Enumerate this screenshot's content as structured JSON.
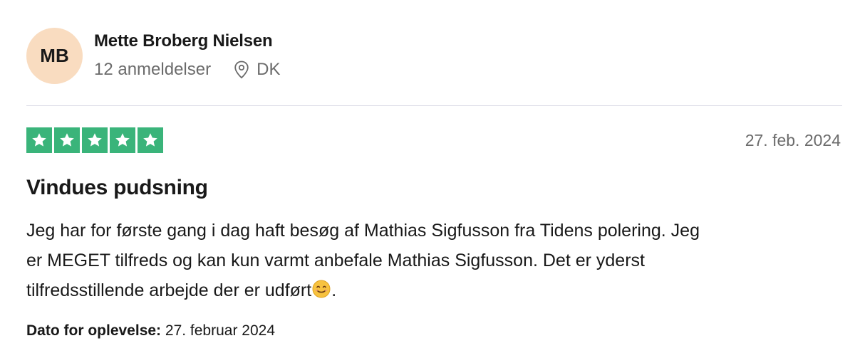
{
  "reviewer": {
    "initials": "MB",
    "avatar_color": "#f9dcc0",
    "name": "Mette Broberg Nielsen",
    "reviews_count": "12 anmeldelser",
    "country": "DK"
  },
  "review": {
    "rating": 5,
    "star_color": "#3ab47a",
    "date": "27. feb. 2024",
    "title": "Vindues pudsning",
    "body_line1": "Jeg har for første gang i dag haft besøg af Mathias Sigfusson fra Tidens polering. Jeg",
    "body_line2": "er MEGET tilfreds og kan kun varmt anbefale Mathias Sigfusson. Det er yderst",
    "body_line3_text": "tilfredsstillende arbejde der er udført",
    "body_line3_emoji": "smiling-face-emoji",
    "body_line3_end": ".",
    "experience_label": "Dato for oplevelse:",
    "experience_date": "27. februar 2024"
  },
  "icons": {
    "location": "location-pin-icon",
    "star": "star-icon"
  }
}
